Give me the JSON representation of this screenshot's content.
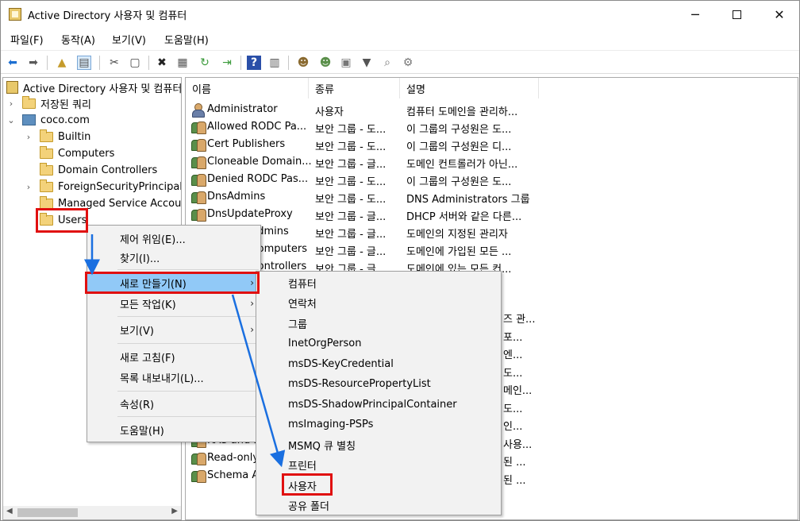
{
  "window": {
    "title": "Active Directory 사용자 및 컴퓨터",
    "minimize_glyph": "─",
    "close_glyph": "✕"
  },
  "menubar": [
    "파일(F)",
    "동작(A)",
    "보기(V)",
    "도움말(H)"
  ],
  "toolbar_icons": [
    "back-icon",
    "forward-icon",
    "up-folder-icon",
    "show-console-tree-icon",
    "cut-icon",
    "copy-icon",
    "delete-icon",
    "properties-icon",
    "refresh-icon",
    "export-list-icon",
    "help-icon",
    "action-pane-icon",
    "new-user-icon",
    "new-group-icon",
    "new-ou-icon",
    "filter-icon",
    "find-icon",
    "delegate-icon"
  ],
  "tree": {
    "root": "Active Directory 사용자 및 컴퓨터",
    "items": [
      {
        "label": "저장된 쿼리",
        "arrow": "›"
      },
      {
        "label": "coco.com",
        "arrow": "⌄"
      },
      {
        "label": "Builtin",
        "arrow": "›"
      },
      {
        "label": "Computers",
        "arrow": ""
      },
      {
        "label": "Domain Controllers",
        "arrow": ""
      },
      {
        "label": "ForeignSecurityPrincipals",
        "arrow": "›"
      },
      {
        "label": "Managed Service Accounts",
        "arrow": ""
      },
      {
        "label": "Users",
        "arrow": ""
      }
    ],
    "scroll_left": "◀",
    "scroll_right": "▶"
  },
  "list": {
    "columns": [
      "이름",
      "종류",
      "설명"
    ],
    "rows": [
      {
        "name": "Administrator",
        "type": "사용자",
        "desc": "컴퓨터 도메인을 관리하...",
        "icon": "user"
      },
      {
        "name": "Allowed RODC Pa...",
        "type": "보안 그룹 - 도...",
        "desc": "이 그룹의 구성원은 도...",
        "icon": "group"
      },
      {
        "name": "Cert Publishers",
        "type": "보안 그룹 - 도...",
        "desc": "이 그룹의 구성원은 디...",
        "icon": "group"
      },
      {
        "name": "Cloneable Domain...",
        "type": "보안 그룹 - 글...",
        "desc": "도메인 컨트롤러가 아닌...",
        "icon": "group"
      },
      {
        "name": "Denied RODC Pas...",
        "type": "보안 그룹 - 도...",
        "desc": "이 그룹의 구성원은 도...",
        "icon": "group"
      },
      {
        "name": "DnsAdmins",
        "type": "보안 그룹 - 도...",
        "desc": "DNS Administrators 그룹",
        "icon": "group"
      },
      {
        "name": "DnsUpdateProxy",
        "type": "보안 그룹 - 글...",
        "desc": "DHCP 서버와 같은 다른...",
        "icon": "group"
      },
      {
        "name": "Domain Admins",
        "type": "보안 그룹 - 글...",
        "desc": "도메인의 지정된 관리자",
        "icon": "group"
      },
      {
        "name": "Domain Computers",
        "type": "보안 그룹 - 글...",
        "desc": "도메인에 가입된 모든 ...",
        "icon": "group"
      },
      {
        "name": "Domain Controllers",
        "type": "보안 그룹 - 글...",
        "desc": "도메인에 있는 모든 컨...",
        "icon": "group"
      }
    ],
    "partial_desc": [
      "즈 관...",
      "포...",
      "엔...",
      "도...",
      "메인...",
      "도...",
      "인...",
      "사용...",
      "된 ...",
      "된 ..."
    ],
    "bottom_rows": [
      {
        "name": "RAS and IAS Servers",
        "icon": "group"
      },
      {
        "name": "Read-only Domain Controllers",
        "icon": "group"
      },
      {
        "name": "Schema Admins",
        "icon": "group"
      }
    ]
  },
  "context_menu": {
    "items": [
      "제어 위임(E)...",
      "찾기(I)...",
      "새로 만들기(N)",
      "모든 작업(K)",
      "보기(V)",
      "새로 고침(F)",
      "목록 내보내기(L)...",
      "속성(R)",
      "도움말(H)"
    ],
    "submenu_arrow": "›"
  },
  "submenu": {
    "items": [
      "컴퓨터",
      "연락처",
      "그룹",
      "InetOrgPerson",
      "msDS-KeyCredential",
      "msDS-ResourcePropertyList",
      "msDS-ShadowPrincipalContainer",
      "msImaging-PSPs",
      "MSMQ 큐 별칭",
      "프린터",
      "사용자",
      "공유 폴더"
    ]
  },
  "colors": {
    "highlight": "#91c9f7",
    "annotation_red": "#e01010",
    "annotation_arrow": "#1a6fe0"
  }
}
